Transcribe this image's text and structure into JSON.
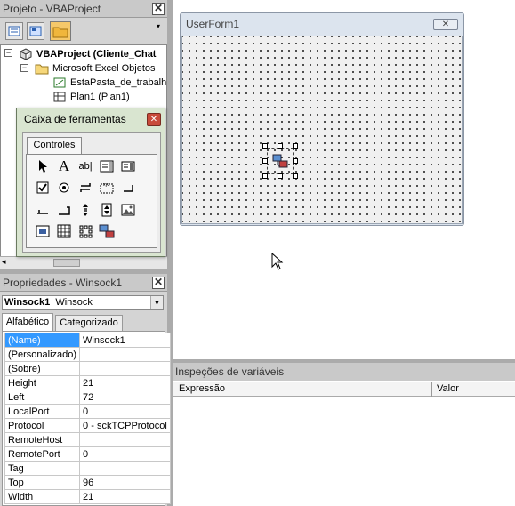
{
  "project": {
    "title": "Projeto - VBAProject",
    "tree": [
      {
        "label": "VBAProject (Cliente_Chat",
        "bold": true
      },
      {
        "label": "Microsoft Excel Objetos"
      },
      {
        "label": "EstaPasta_de_trabalh"
      },
      {
        "label": "Plan1 (Plan1)"
      }
    ]
  },
  "toolbox": {
    "title": "Caixa de ferramentas",
    "tab": "Controles",
    "tools": [
      "pointer-icon",
      "label-icon",
      "textbox-icon",
      "combobox-icon",
      "listbox-icon",
      "checkbox-icon",
      "optionbutton-icon",
      "togglebutton-icon",
      "frame-icon",
      "commandbutton-icon",
      "tabstrip-icon",
      "multipage-icon",
      "scrollbar-icon",
      "spinbutton-icon",
      "image-icon",
      "refedit-icon",
      "winsock-icon-1",
      "winsock-icon-2",
      "winsock-icon-3"
    ]
  },
  "properties": {
    "title": "Propriedades - Winsock1",
    "object_name": "Winsock1",
    "object_type": "Winsock",
    "tabs": [
      "Alfabético",
      "Categorizado"
    ],
    "rows": [
      {
        "name": "(Name)",
        "value": "Winsock1"
      },
      {
        "name": "(Personalizado)",
        "value": ""
      },
      {
        "name": "(Sobre)",
        "value": ""
      },
      {
        "name": "Height",
        "value": "21"
      },
      {
        "name": "Left",
        "value": "72"
      },
      {
        "name": "LocalPort",
        "value": "0"
      },
      {
        "name": "Protocol",
        "value": "0 - sckTCPProtocol"
      },
      {
        "name": "RemoteHost",
        "value": ""
      },
      {
        "name": "RemotePort",
        "value": "0"
      },
      {
        "name": "Tag",
        "value": ""
      },
      {
        "name": "Top",
        "value": "96"
      },
      {
        "name": "Width",
        "value": "21"
      }
    ]
  },
  "userform": {
    "title": "UserForm1"
  },
  "watch": {
    "title": "Inspeções de variáveis",
    "columns": [
      "Expressão",
      "Valor"
    ]
  }
}
